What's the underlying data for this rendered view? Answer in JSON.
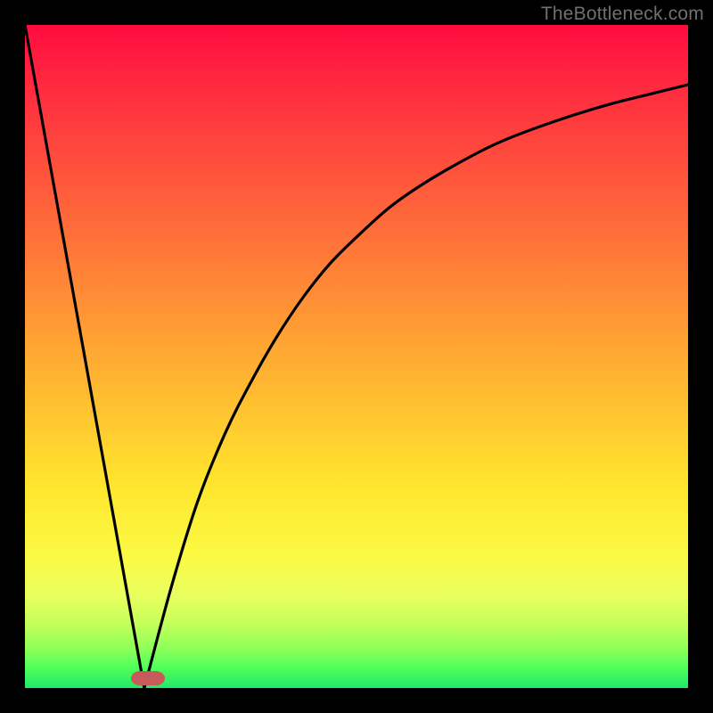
{
  "watermark": "TheBottleneck.com",
  "chart_data": {
    "type": "line",
    "title": "",
    "xlabel": "",
    "ylabel": "",
    "xlim": [
      0,
      100
    ],
    "ylim": [
      0,
      100
    ],
    "grid": false,
    "series": [
      {
        "name": "left-branch",
        "x": [
          0,
          18
        ],
        "y": [
          100,
          0
        ]
      },
      {
        "name": "right-branch",
        "x": [
          18,
          22,
          26,
          30,
          34,
          38,
          42,
          46,
          50,
          55,
          60,
          66,
          72,
          80,
          88,
          94,
          100
        ],
        "y": [
          0,
          15,
          28,
          38,
          46,
          53,
          59,
          64,
          68,
          72.5,
          76,
          79.5,
          82.5,
          85.5,
          88,
          89.5,
          91
        ]
      }
    ],
    "marker": {
      "x": 18.5,
      "y": 1.5
    },
    "gradient_stops": [
      {
        "pct": 0,
        "color": "#ff0b3e"
      },
      {
        "pct": 35,
        "color": "#ff7a38"
      },
      {
        "pct": 70,
        "color": "#ffe72e"
      },
      {
        "pct": 100,
        "color": "#20e869"
      }
    ]
  }
}
